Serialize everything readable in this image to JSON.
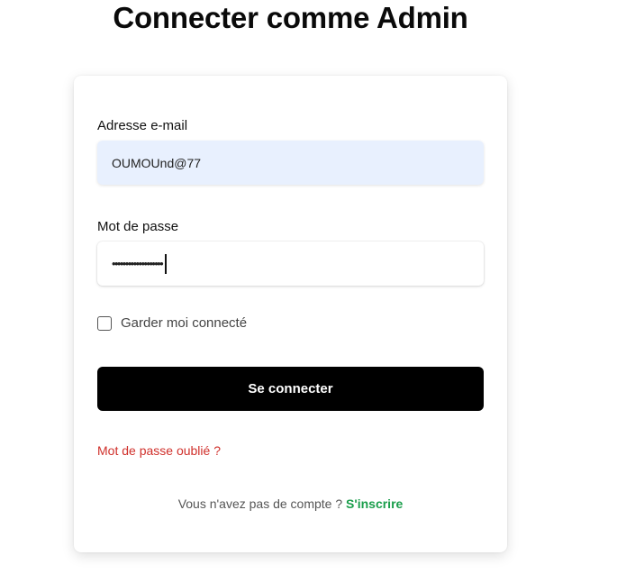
{
  "page": {
    "title": "Connecter comme Admin"
  },
  "form": {
    "email_label": "Adresse e-mail",
    "email_value": "OUMOUnd@77",
    "password_label": "Mot de passe",
    "password_mask": "•••••••••••••••••••",
    "remember_label": "Garder moi connecté",
    "remember_checked": false,
    "submit_label": "Se connecter",
    "forgot_label": "Mot de passe oublié ?",
    "signup_prompt": "Vous n'avez pas de compte ?",
    "signup_link": "S'inscrire"
  },
  "colors": {
    "submit_bg": "#000000",
    "forgot_link": "#d0302b",
    "signup_link": "#1a9e4b",
    "email_autofill_bg": "#e8f0fe"
  }
}
